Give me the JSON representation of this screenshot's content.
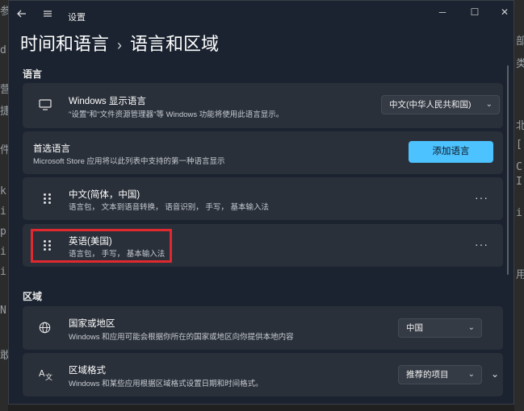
{
  "background": {
    "left_glyphs": [
      "参",
      "d",
      "营",
      "捷",
      "件",
      "k",
      "i",
      "p",
      "i",
      "i",
      "N",
      "敢"
    ],
    "right_glyphs": [
      "部",
      "类",
      "北",
      "[",
      "C",
      "I",
      "i",
      "用"
    ]
  },
  "window": {
    "title": "设置",
    "back_icon": "arrow-left-icon",
    "menu_icon": "hamburger-icon",
    "controls": {
      "minimize": "─",
      "maximize": "☐",
      "close": "✕"
    }
  },
  "breadcrumb": {
    "parent": "时间和语言",
    "separator": "›",
    "current": "语言和区域"
  },
  "language_section": {
    "label": "语言",
    "display_language": {
      "title": "Windows 显示语言",
      "desc": "\"设置\"和\"文件资源管理器\"等 Windows 功能将使用此语言显示。",
      "value": "中文(中华人民共和国)",
      "icon": "monitor-icon"
    },
    "preferred": {
      "title": "首选语言",
      "desc": "Microsoft Store 应用将以此列表中支持的第一种语言显示",
      "button": "添加语言"
    },
    "languages": [
      {
        "name": "中文(简体，中国)",
        "features": "语言包， 文本到语音转换， 语音识别， 手写， 基本输入法",
        "more": "···"
      },
      {
        "name": "英语(美国)",
        "features": "语言包， 手写， 基本输入法",
        "more": "···"
      }
    ]
  },
  "region_section": {
    "label": "区域",
    "country": {
      "title": "国家或地区",
      "desc": "Windows 和应用可能会根据你所在的国家或地区向你提供本地内容",
      "value": "中国",
      "icon": "globe-icon"
    },
    "format": {
      "title": "区域格式",
      "desc": "Windows 和某些应用根据区域格式设置日期和时间格式。",
      "value": "推荐的项目",
      "icon": "language-icon"
    }
  },
  "colors": {
    "accent": "#4cc2ff",
    "highlight": "#e0282f",
    "card": "#2a303a",
    "window": "#1b2330"
  }
}
